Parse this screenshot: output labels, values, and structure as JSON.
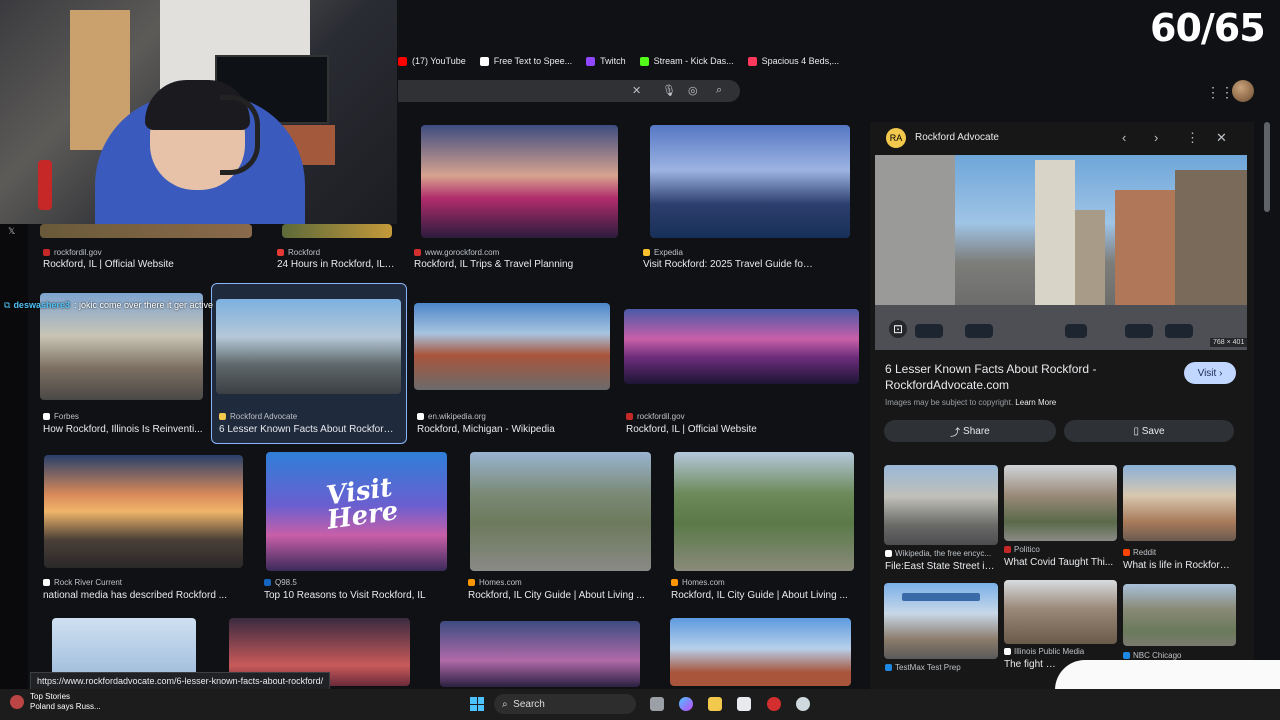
{
  "overlay": {
    "counter": "60/65"
  },
  "bookmarks": [
    {
      "label": "(17) YouTube",
      "color": "#ff0000"
    },
    {
      "label": "Free Text to Spee...",
      "color": "#ffffff"
    },
    {
      "label": "Twitch",
      "color": "#9146ff"
    },
    {
      "label": "Stream - Kick Das...",
      "color": "#53fc18"
    },
    {
      "label": "Spacious 4 Beds,...",
      "color": "#ff385c"
    }
  ],
  "chat": {
    "user": "deswashere3",
    "message": ": jokic come over there it ger active"
  },
  "grid": [
    {
      "src": "rockfordil.gov",
      "title": "Rockford, IL | Official Website",
      "fav": "#c62828"
    },
    {
      "src": "Rockford",
      "title": "24 Hours in Rockford, IL ...",
      "fav": "#e53935"
    },
    {
      "src": "www.gorockford.com",
      "title": "Rockford, IL Trips & Travel Planning",
      "fav": "#d32f2f"
    },
    {
      "src": "Expedia",
      "title": "Visit Rockford: 2025 Travel Guide for ...",
      "fav": "#fbc02d"
    },
    {
      "src": "Forbes",
      "title": "How Rockford, Illinois Is Reinventi...",
      "fav": "#ffffff"
    },
    {
      "src": "Rockford Advocate",
      "title": "6 Lesser Known Facts About Rockford ...",
      "fav": "#f2c94c"
    },
    {
      "src": "en.wikipedia.org",
      "title": "Rockford, Michigan - Wikipedia",
      "fav": "#ffffff"
    },
    {
      "src": "rockfordil.gov",
      "title": "Rockford, IL | Official Website",
      "fav": "#c62828"
    },
    {
      "src": "Rock River Current",
      "title": "national media has described Rockford ...",
      "fav": "#ffffff"
    },
    {
      "src": "Q98.5",
      "title": "Top 10 Reasons to Visit Rockford, IL",
      "fav": "#1565c0"
    },
    {
      "src": "Homes.com",
      "title": "Rockford, IL City Guide | About Living ...",
      "fav": "#ff9800"
    },
    {
      "src": "Homes.com",
      "title": "Rockford, IL City Guide | About Living ...",
      "fav": "#ff9800"
    }
  ],
  "tiles": {
    "visit_here": "Visit Here"
  },
  "panel": {
    "source": "Rockford Advocate",
    "title": "6 Lesser Known Facts About Rockford - RockfordAdvocate.com",
    "visit_label": "Visit",
    "dims": "768 × 401",
    "copyright": "Images may be subject to copyright.",
    "learn_more": "Learn More",
    "share_label": "Share",
    "save_label": "Save",
    "related": [
      {
        "src": "Wikipedia, the free encyc...",
        "title": "File:East State Street in...",
        "fav": "#ffffff"
      },
      {
        "src": "Politico",
        "title": "What Covid Taught Thi...",
        "fav": "#c62828"
      },
      {
        "src": "Reddit",
        "title": "What is life in Rockford,...",
        "fav": "#ff4500"
      },
      {
        "src": "TestMax Test Prep",
        "title": "",
        "fav": "#1e88e5"
      },
      {
        "src": "Illinois Public Media",
        "title": "The fight to e",
        "fav": "#ffffff"
      },
      {
        "src": "NBC Chicago",
        "title": "",
        "fav": "#1e88e5"
      }
    ]
  },
  "status_url": "https://www.rockfordadvocate.com/6-lesser-known-facts-about-rockford/",
  "taskbar": {
    "news_title": "Top Stories",
    "news_sub": "Poland says Russ...",
    "search_label": "Search"
  }
}
